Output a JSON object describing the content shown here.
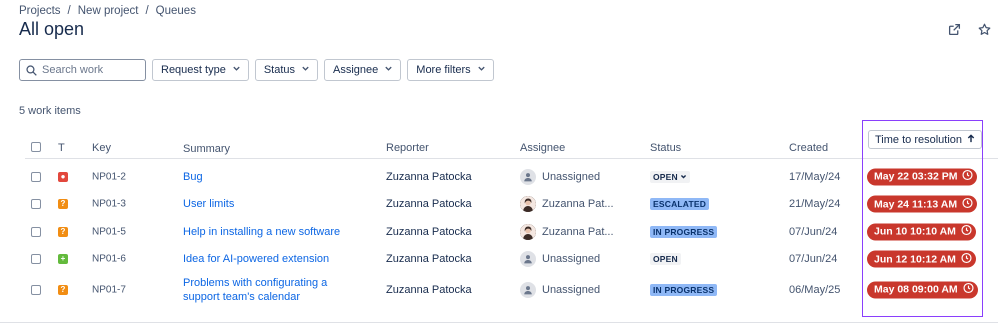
{
  "breadcrumb": [
    "Projects",
    "New project",
    "Queues"
  ],
  "page_title": "All open",
  "search": {
    "placeholder": "Search work",
    "value": ""
  },
  "filters": [
    "Request type",
    "Status",
    "Assignee",
    "More filters"
  ],
  "count_text": "5 work items",
  "columns": {
    "type": "T",
    "key": "Key",
    "summary": "Summary",
    "reporter": "Reporter",
    "assignee": "Assignee",
    "status": "Status",
    "created": "Created",
    "ttr": "Time to resolution"
  },
  "rows": [
    {
      "type_icon": "bug-icon",
      "type_color": "#e2483d",
      "key": "NP01-2",
      "summary": [
        "Bug"
      ],
      "reporter": "Zuzanna Patocka",
      "assignee": "Unassigned",
      "assignee_avatar": "unassigned-avatar-icon",
      "status": "OPEN",
      "status_style": "grey",
      "status_dropdown": true,
      "created": "17/May/24",
      "ttr": "May 22 03:32 PM"
    },
    {
      "type_icon": "question-icon",
      "type_color": "#f18d13",
      "key": "NP01-3",
      "summary": [
        "User limits"
      ],
      "reporter": "Zuzanna Patocka",
      "assignee": "Zuzanna Pat...",
      "assignee_avatar": "user-avatar",
      "status": "ESCALATED",
      "status_style": "blue",
      "status_dropdown": false,
      "created": "21/May/24",
      "ttr": "May 24 11:13 AM"
    },
    {
      "type_icon": "question-icon",
      "type_color": "#f18d13",
      "key": "NP01-5",
      "summary": [
        "Help in installing a new software"
      ],
      "reporter": "Zuzanna Patocka",
      "assignee": "Zuzanna Pat...",
      "assignee_avatar": "user-avatar",
      "status": "IN PROGRESS",
      "status_style": "blue",
      "status_dropdown": false,
      "created": "07/Jun/24",
      "ttr": "Jun 10 10:10 AM"
    },
    {
      "type_icon": "plus-icon",
      "type_color": "#63ba3c",
      "key": "NP01-6",
      "summary": [
        "Idea for AI-powered extension"
      ],
      "reporter": "Zuzanna Patocka",
      "assignee": "Unassigned",
      "assignee_avatar": "unassigned-avatar-icon",
      "status": "OPEN",
      "status_style": "grey",
      "status_dropdown": false,
      "created": "07/Jun/24",
      "ttr": "Jun 12 10:12 AM"
    },
    {
      "type_icon": "question-icon",
      "type_color": "#f18d13",
      "key": "NP01-7",
      "summary": [
        "Problems with configurating a",
        "support team's calendar"
      ],
      "reporter": "Zuzanna Patocka",
      "assignee": "Unassigned",
      "assignee_avatar": "unassigned-avatar-icon",
      "status": "IN PROGRESS",
      "status_style": "blue",
      "status_dropdown": false,
      "created": "06/May/25",
      "ttr": "May 08 09:00 AM"
    }
  ],
  "colors": {
    "link": "#0c66e4",
    "ttr_pill": "#c9372c",
    "highlight_box": "#8a3ffc"
  },
  "icons": {
    "share": "share-icon",
    "star": "star-icon",
    "search": "search-icon",
    "sort": "arrow-up-icon",
    "clock": "clock-icon"
  }
}
